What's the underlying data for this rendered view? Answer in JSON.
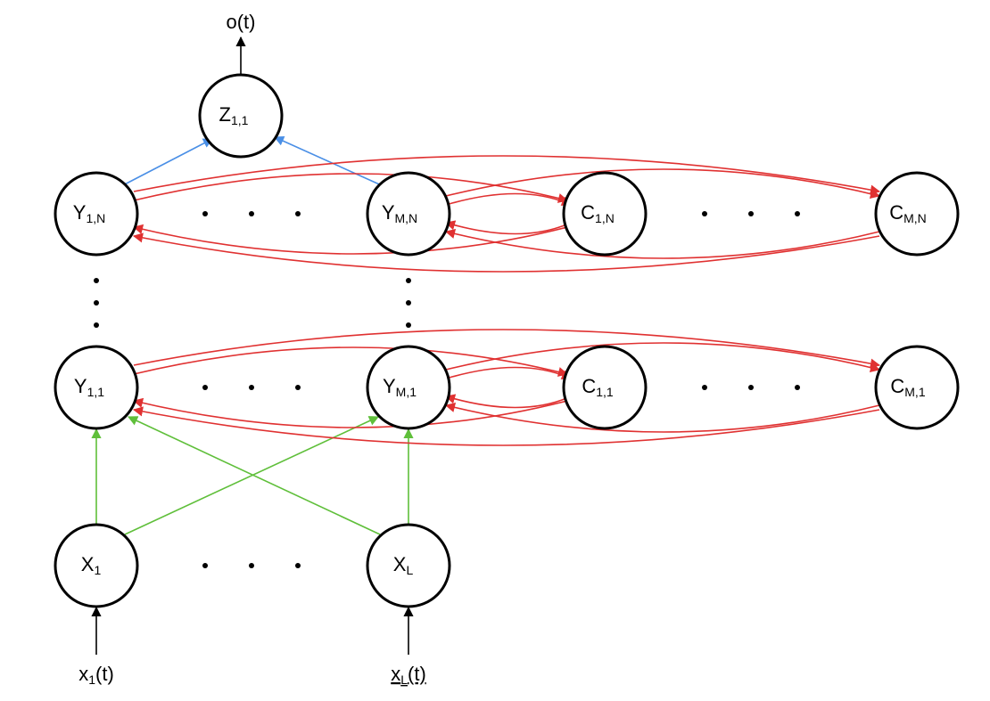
{
  "output_label": "o(t)",
  "nodes": {
    "Z": {
      "label": "Z",
      "sub": "1,1"
    },
    "Y1N": {
      "label": "Y",
      "sub": "1,N"
    },
    "YMN": {
      "label": "Y",
      "sub": "M,N"
    },
    "C1N": {
      "label": "C",
      "sub": "1,N"
    },
    "CMN": {
      "label": "C",
      "sub": "M,N"
    },
    "Y11": {
      "label": "Y",
      "sub": "1,1"
    },
    "YM1": {
      "label": "Y",
      "sub": "M,1"
    },
    "C11": {
      "label": "C",
      "sub": "1,1"
    },
    "CM1": {
      "label": "C",
      "sub": "M,1"
    },
    "X1": {
      "label": "X",
      "sub": "1"
    },
    "XL": {
      "label": "X",
      "sub": "L"
    }
  },
  "inputs": {
    "x1": {
      "main": "x",
      "sub": "1",
      "tail": "(t)"
    },
    "xL": {
      "main": "x",
      "sub": "L",
      "tail": "(t)"
    }
  },
  "colors": {
    "green": "#5fbf3a",
    "blue": "#4a8fe6",
    "red": "#e03131",
    "black": "#000000"
  },
  "chart_data": {
    "type": "diagram",
    "description": "Layered recurrent neural network / LSTM-style architecture",
    "layers": [
      {
        "name": "input",
        "nodes": [
          "X_1",
          "...",
          "X_L"
        ],
        "external_inputs": [
          "x_1(t)",
          "x_L(t)"
        ]
      },
      {
        "name": "hidden_1",
        "nodes": [
          "Y_1,1",
          "...",
          "Y_M,1"
        ],
        "cell_state": [
          "C_1,1",
          "...",
          "C_M,1"
        ]
      },
      {
        "name": "hidden_N",
        "nodes": [
          "Y_1,N",
          "...",
          "Y_M,N"
        ],
        "cell_state": [
          "C_1,N",
          "...",
          "C_M,N"
        ]
      },
      {
        "name": "output",
        "nodes": [
          "Z_1,1"
        ],
        "external_output": "o(t)"
      }
    ],
    "edges": [
      {
        "from": "x_1(t)",
        "to": "X_1",
        "color": "black"
      },
      {
        "from": "x_L(t)",
        "to": "X_L",
        "color": "black"
      },
      {
        "from": "X_1",
        "to": "Y_1,1",
        "color": "green"
      },
      {
        "from": "X_1",
        "to": "Y_M,1",
        "color": "green"
      },
      {
        "from": "X_L",
        "to": "Y_1,1",
        "color": "green"
      },
      {
        "from": "X_L",
        "to": "Y_M,1",
        "color": "green"
      },
      {
        "from": "Y_1,1",
        "to": "C_1,1",
        "color": "red",
        "bidirectional": true
      },
      {
        "from": "Y_1,1",
        "to": "C_M,1",
        "color": "red",
        "bidirectional": true
      },
      {
        "from": "Y_M,1",
        "to": "C_1,1",
        "color": "red",
        "bidirectional": true
      },
      {
        "from": "Y_M,1",
        "to": "C_M,1",
        "color": "red",
        "bidirectional": true
      },
      {
        "from": "Y_1,N",
        "to": "C_1,N",
        "color": "red",
        "bidirectional": true
      },
      {
        "from": "Y_1,N",
        "to": "C_M,N",
        "color": "red",
        "bidirectional": true
      },
      {
        "from": "Y_M,N",
        "to": "C_1,N",
        "color": "red",
        "bidirectional": true
      },
      {
        "from": "Y_M,N",
        "to": "C_M,N",
        "color": "red",
        "bidirectional": true
      },
      {
        "from": "Y_1,N",
        "to": "Z_1,1",
        "color": "blue"
      },
      {
        "from": "Y_M,N",
        "to": "Z_1,1",
        "color": "blue"
      },
      {
        "from": "Z_1,1",
        "to": "o(t)",
        "color": "black"
      }
    ]
  }
}
